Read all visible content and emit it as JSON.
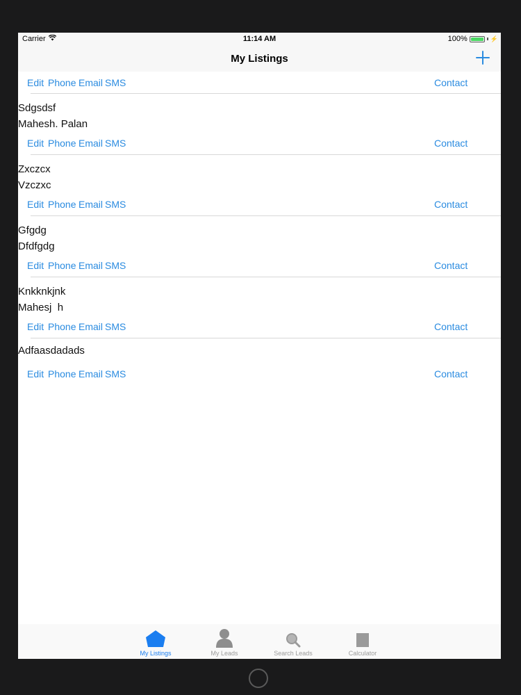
{
  "status": {
    "carrier": "Carrier",
    "time": "11:14 AM",
    "battery_level": "100%",
    "battery_fraction": 1.0
  },
  "navbar": {
    "title": "My Listings",
    "add_icon": "plus-icon"
  },
  "top_actions": {
    "edit": "Edit",
    "phone": "Phone",
    "email": "Email",
    "sms": "SMS",
    "contact": "Contact"
  },
  "listings": [
    {
      "line1": "Sdgsdsf",
      "line2": "Mahesh. Palan",
      "edit": "Edit",
      "phone": "Phone",
      "email": "Email",
      "sms": "SMS",
      "contact": "Contact"
    },
    {
      "line1": "Zxczcx",
      "line2": "Vzczxc",
      "edit": "Edit",
      "phone": "Phone",
      "email": "Email",
      "sms": "SMS",
      "contact": "Contact"
    },
    {
      "line1": "Gfgdg",
      "line2": "Dfdfgdg",
      "edit": "Edit",
      "phone": "Phone",
      "email": "Email",
      "sms": "SMS",
      "contact": "Contact"
    },
    {
      "line1": "Knkknkjnk",
      "line2": "Mahesj  h",
      "edit": "Edit",
      "phone": "Phone",
      "email": "Email",
      "sms": "SMS",
      "contact": "Contact"
    },
    {
      "line1": "Adfaasdadads",
      "line2": "",
      "edit": "Edit",
      "phone": "Phone",
      "email": "Email",
      "sms": "SMS",
      "contact": "Contact"
    }
  ],
  "tabbar": {
    "tabs": [
      {
        "label": "My Listings",
        "icon": "house-icon",
        "active": true
      },
      {
        "label": "My Leads",
        "icon": "person-icon",
        "active": false
      },
      {
        "label": "Search Leads",
        "icon": "magnifier-icon",
        "active": false
      },
      {
        "label": "Calculator",
        "icon": "calculator-icon",
        "active": false
      }
    ]
  },
  "colors": {
    "accent": "#2a8be0",
    "tab_active": "#1b7ef0",
    "tab_inactive": "#9b9b9b",
    "separator": "#d8d8d8"
  }
}
